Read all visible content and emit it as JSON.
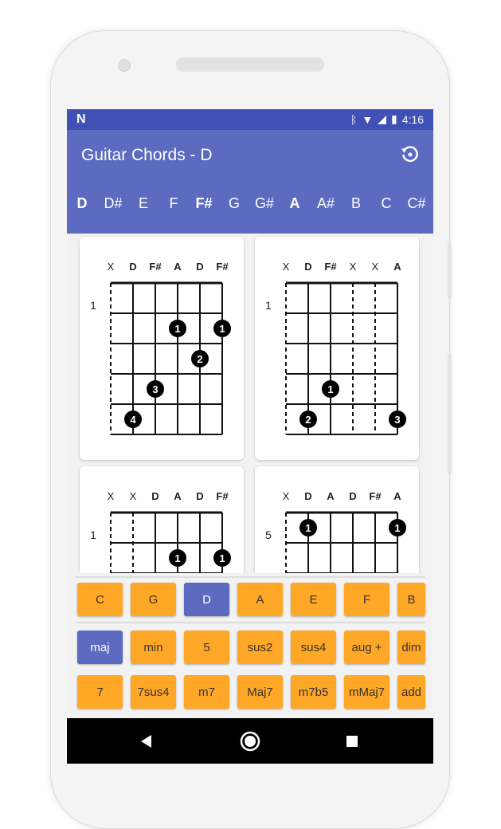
{
  "status_bar": {
    "time": "4:16"
  },
  "app_bar": {
    "title": "Guitar Chords - D"
  },
  "notes": [
    {
      "label": "D",
      "bold": true
    },
    {
      "label": "D#",
      "bold": false
    },
    {
      "label": "E",
      "bold": false
    },
    {
      "label": "F",
      "bold": false
    },
    {
      "label": "F#",
      "bold": true
    },
    {
      "label": "G",
      "bold": false
    },
    {
      "label": "G#",
      "bold": false
    },
    {
      "label": "A",
      "bold": true
    },
    {
      "label": "A#",
      "bold": false
    },
    {
      "label": "B",
      "bold": false
    },
    {
      "label": "C",
      "bold": false
    },
    {
      "label": "C#",
      "bold": false
    }
  ],
  "chords": [
    {
      "strings": [
        "X",
        "D",
        "F#",
        "A",
        "D",
        "F#"
      ],
      "fret": "1",
      "muted": [
        0
      ],
      "dots": [
        {
          "s": 3,
          "f": 2,
          "n": "1"
        },
        {
          "s": 5,
          "f": 2,
          "n": "1"
        },
        {
          "s": 4,
          "f": 3,
          "n": "2"
        },
        {
          "s": 2,
          "f": 4,
          "n": "3"
        },
        {
          "s": 1,
          "f": 5,
          "n": "4"
        }
      ]
    },
    {
      "strings": [
        "X",
        "D",
        "F#",
        "X",
        "X",
        "A"
      ],
      "fret": "1",
      "muted": [
        0,
        3,
        4
      ],
      "dots": [
        {
          "s": 2,
          "f": 4,
          "n": "1"
        },
        {
          "s": 1,
          "f": 5,
          "n": "2"
        },
        {
          "s": 5,
          "f": 5,
          "n": "3"
        }
      ]
    },
    {
      "strings": [
        "X",
        "X",
        "D",
        "A",
        "D",
        "F#"
      ],
      "fret": "1",
      "muted": [
        0,
        1
      ],
      "dots": [
        {
          "s": 3,
          "f": 2,
          "n": "1"
        },
        {
          "s": 5,
          "f": 2,
          "n": "1"
        }
      ]
    },
    {
      "strings": [
        "X",
        "D",
        "A",
        "D",
        "F#",
        "A"
      ],
      "fret": "5",
      "muted": [
        0
      ],
      "dots": [
        {
          "s": 1,
          "f": 1,
          "n": "1"
        },
        {
          "s": 5,
          "f": 1,
          "n": "1"
        }
      ]
    }
  ],
  "root_buttons": [
    {
      "label": "C",
      "active": false
    },
    {
      "label": "G",
      "active": false
    },
    {
      "label": "D",
      "active": true
    },
    {
      "label": "A",
      "active": false
    },
    {
      "label": "E",
      "active": false
    },
    {
      "label": "F",
      "active": false
    },
    {
      "label": "B",
      "active": false
    }
  ],
  "type_buttons_row1": [
    {
      "label": "maj",
      "active": true
    },
    {
      "label": "min",
      "active": false
    },
    {
      "label": "5",
      "active": false
    },
    {
      "label": "sus2",
      "active": false
    },
    {
      "label": "sus4",
      "active": false
    },
    {
      "label": "aug +",
      "active": false
    },
    {
      "label": "dim",
      "active": false
    }
  ],
  "type_buttons_row2": [
    {
      "label": "7",
      "active": false
    },
    {
      "label": "7sus4",
      "active": false
    },
    {
      "label": "m7",
      "active": false
    },
    {
      "label": "Maj7",
      "active": false
    },
    {
      "label": "m7b5",
      "active": false
    },
    {
      "label": "mMaj7",
      "active": false
    },
    {
      "label": "add",
      "active": false
    }
  ],
  "colors": {
    "primary_dark": "#3f51b5",
    "primary": "#5c6bc0",
    "accent": "#ffa726"
  },
  "icons": {
    "history": "history-icon",
    "back": "back-triangle-icon",
    "home": "home-circle-icon",
    "recents": "recents-square-icon"
  }
}
